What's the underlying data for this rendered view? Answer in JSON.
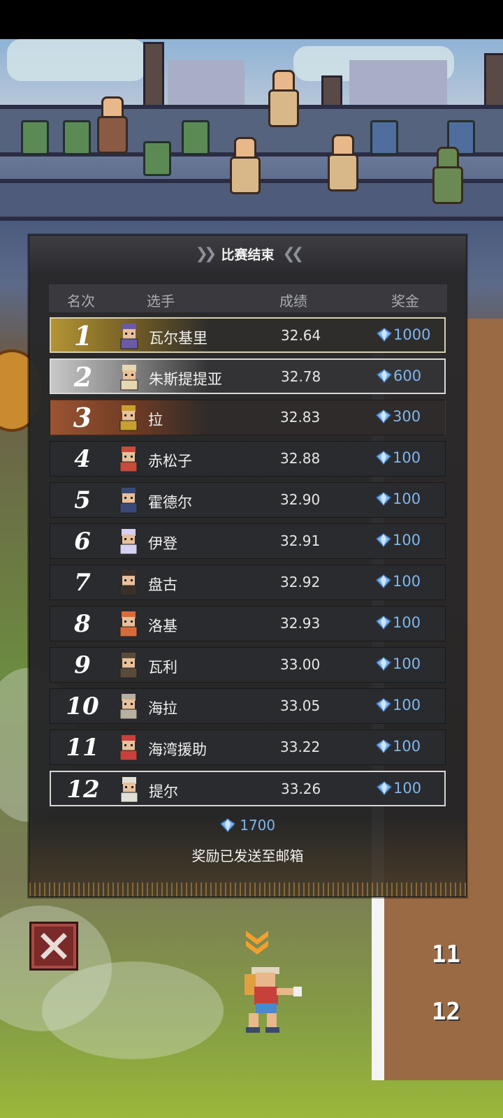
{
  "panel": {
    "title": "比赛结束",
    "headers": {
      "rank": "名次",
      "player": "选手",
      "score": "成绩",
      "prize": "奖金"
    },
    "rows": [
      {
        "rank": "1",
        "name": "瓦尔基里",
        "score": "32.64",
        "prize": "1000",
        "style": "gold",
        "avatar_color": "#6a5aa8"
      },
      {
        "rank": "2",
        "name": "朱斯提提亚",
        "score": "32.78",
        "prize": "600",
        "style": "silver",
        "avatar_color": "#e6d7b0"
      },
      {
        "rank": "3",
        "name": "拉",
        "score": "32.83",
        "prize": "300",
        "style": "bronze",
        "avatar_color": "#c9a030"
      },
      {
        "rank": "4",
        "name": "赤松子",
        "score": "32.88",
        "prize": "100",
        "style": "normal",
        "avatar_color": "#c84a3a"
      },
      {
        "rank": "5",
        "name": "霍德尔",
        "score": "32.90",
        "prize": "100",
        "style": "normal",
        "avatar_color": "#3a4a78"
      },
      {
        "rank": "6",
        "name": "伊登",
        "score": "32.91",
        "prize": "100",
        "style": "normal",
        "avatar_color": "#d8d0f0"
      },
      {
        "rank": "7",
        "name": "盘古",
        "score": "32.92",
        "prize": "100",
        "style": "normal",
        "avatar_color": "#3a3028"
      },
      {
        "rank": "8",
        "name": "洛基",
        "score": "32.93",
        "prize": "100",
        "style": "normal",
        "avatar_color": "#d86a3a"
      },
      {
        "rank": "9",
        "name": "瓦利",
        "score": "33.00",
        "prize": "100",
        "style": "normal",
        "avatar_color": "#5a4a3a"
      },
      {
        "rank": "10",
        "name": "海拉",
        "score": "33.05",
        "prize": "100",
        "style": "normal",
        "avatar_color": "#b8b0a0"
      },
      {
        "rank": "11",
        "name": "海湾援助",
        "score": "33.22",
        "prize": "100",
        "style": "normal",
        "avatar_color": "#c8403a"
      },
      {
        "rank": "12",
        "name": "提尔",
        "score": "33.26",
        "prize": "100",
        "style": "self",
        "avatar_color": "#e0e0d8"
      }
    ],
    "total": "1700",
    "mail_notice": "奖励已发送至邮箱"
  },
  "track_numbers": [
    "11",
    "12"
  ],
  "icons": {
    "gem": "diamond-gem-icon",
    "close": "close-icon",
    "marker": "player-marker-icon"
  },
  "colors": {
    "gem": "#7fb6ee",
    "gold": "#b49434",
    "silver": "#c8c8c8",
    "bronze": "#9a5432"
  }
}
